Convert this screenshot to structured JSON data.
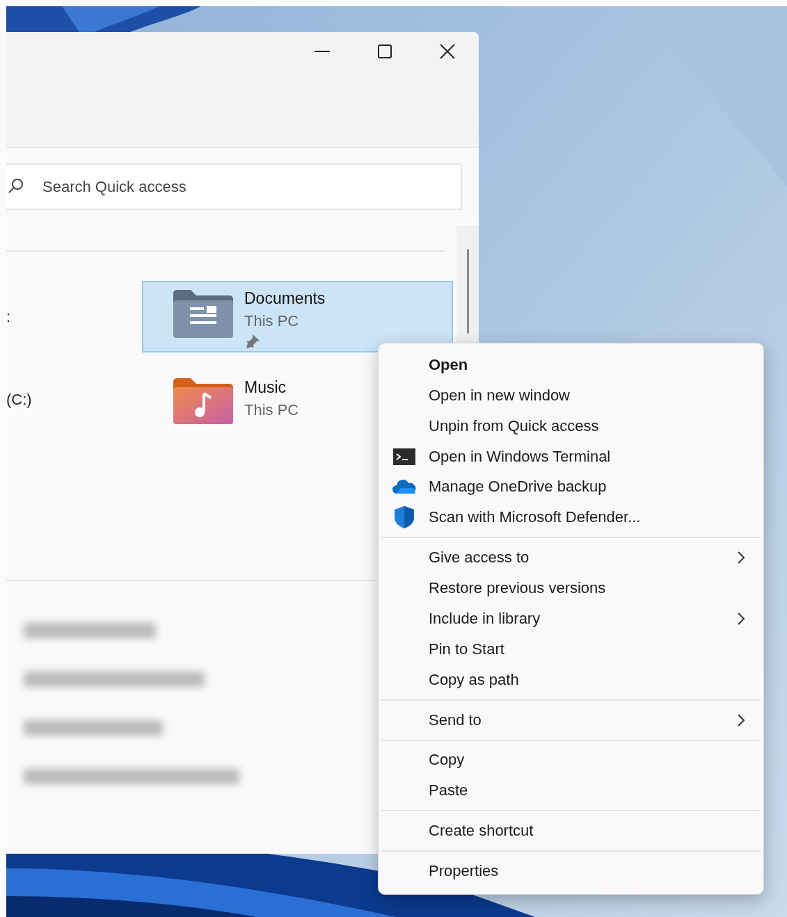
{
  "explorer": {
    "window_controls": [
      {
        "kind": "minimize"
      },
      {
        "kind": "maximize"
      },
      {
        "kind": "close"
      }
    ],
    "search": {
      "placeholder": "Search Quick access"
    },
    "side_labels": [
      ":",
      "(C:)"
    ],
    "folders": [
      {
        "name": "Documents",
        "location": "This PC",
        "kind": "documents",
        "pinned": true,
        "selected": true
      },
      {
        "name": "Music",
        "location": "This PC",
        "kind": "music",
        "pinned": false,
        "selected": false
      }
    ]
  },
  "context_menu": {
    "sections": [
      [
        {
          "label": "Open",
          "default": true,
          "submenu": false
        },
        {
          "label": "Open in new window",
          "default": false,
          "submenu": false
        },
        {
          "label": "Unpin from Quick access",
          "default": false,
          "submenu": false
        },
        {
          "label": "Open in Windows Terminal",
          "kind": "terminal",
          "default": false,
          "submenu": false
        },
        {
          "label": "Manage OneDrive backup",
          "kind": "cloud",
          "default": false,
          "submenu": false
        },
        {
          "label": "Scan with Microsoft Defender...",
          "kind": "shield",
          "default": false,
          "submenu": false
        }
      ],
      [
        {
          "label": "Give access to",
          "default": false,
          "submenu": true
        },
        {
          "label": "Restore previous versions",
          "default": false,
          "submenu": false
        },
        {
          "label": "Include in library",
          "default": false,
          "submenu": true
        },
        {
          "label": "Pin to Start",
          "default": false,
          "submenu": false
        },
        {
          "label": "Copy as path",
          "default": false,
          "submenu": false
        }
      ],
      [
        {
          "label": "Send to",
          "default": false,
          "submenu": true
        }
      ],
      [
        {
          "label": "Copy",
          "default": false,
          "submenu": false
        },
        {
          "label": "Paste",
          "default": false,
          "submenu": false
        }
      ],
      [
        {
          "label": "Create shortcut",
          "default": false,
          "submenu": false
        }
      ],
      [
        {
          "label": "Properties",
          "default": false,
          "submenu": false
        }
      ]
    ]
  }
}
